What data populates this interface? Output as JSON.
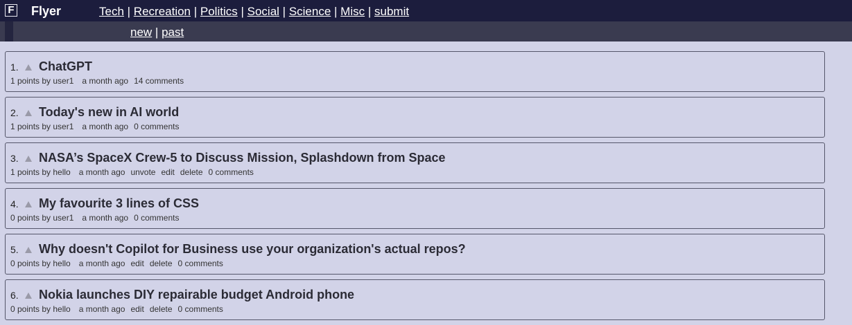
{
  "header": {
    "logo_letter": "F",
    "brand": "Flyer",
    "nav": [
      "Tech",
      "Recreation",
      "Politics",
      "Social",
      "Science",
      "Misc",
      "submit"
    ],
    "separator": " | "
  },
  "subnav": {
    "items": [
      "new",
      "past"
    ],
    "separator": " | "
  },
  "posts": [
    {
      "rank": "1.",
      "title": "ChatGPT",
      "points": "1 points by user1",
      "time": "a month ago",
      "actions": [],
      "comments": "14 comments"
    },
    {
      "rank": "2.",
      "title": "Today's new in AI world",
      "points": "1 points by user1",
      "time": "a month ago",
      "actions": [],
      "comments": "0 comments"
    },
    {
      "rank": "3.",
      "title": "NASA’s SpaceX Crew-5 to Discuss Mission, Splashdown from Space",
      "points": "1 points by hello",
      "time": "a month ago",
      "actions": [
        "unvote",
        "edit",
        "delete"
      ],
      "comments": "0 comments"
    },
    {
      "rank": "4.",
      "title": "My favourite 3 lines of CSS",
      "points": "0 points by user1",
      "time": "a month ago",
      "actions": [],
      "comments": "0 comments"
    },
    {
      "rank": "5.",
      "title": "Why doesn't Copilot for Business use your organization's actual repos?",
      "points": "0 points by hello",
      "time": "a month ago",
      "actions": [
        "edit",
        "delete"
      ],
      "comments": "0 comments"
    },
    {
      "rank": "6.",
      "title": "Nokia launches DIY repairable budget Android phone",
      "points": "0 points by hello",
      "time": "a month ago",
      "actions": [
        "edit",
        "delete"
      ],
      "comments": "0 comments"
    }
  ]
}
